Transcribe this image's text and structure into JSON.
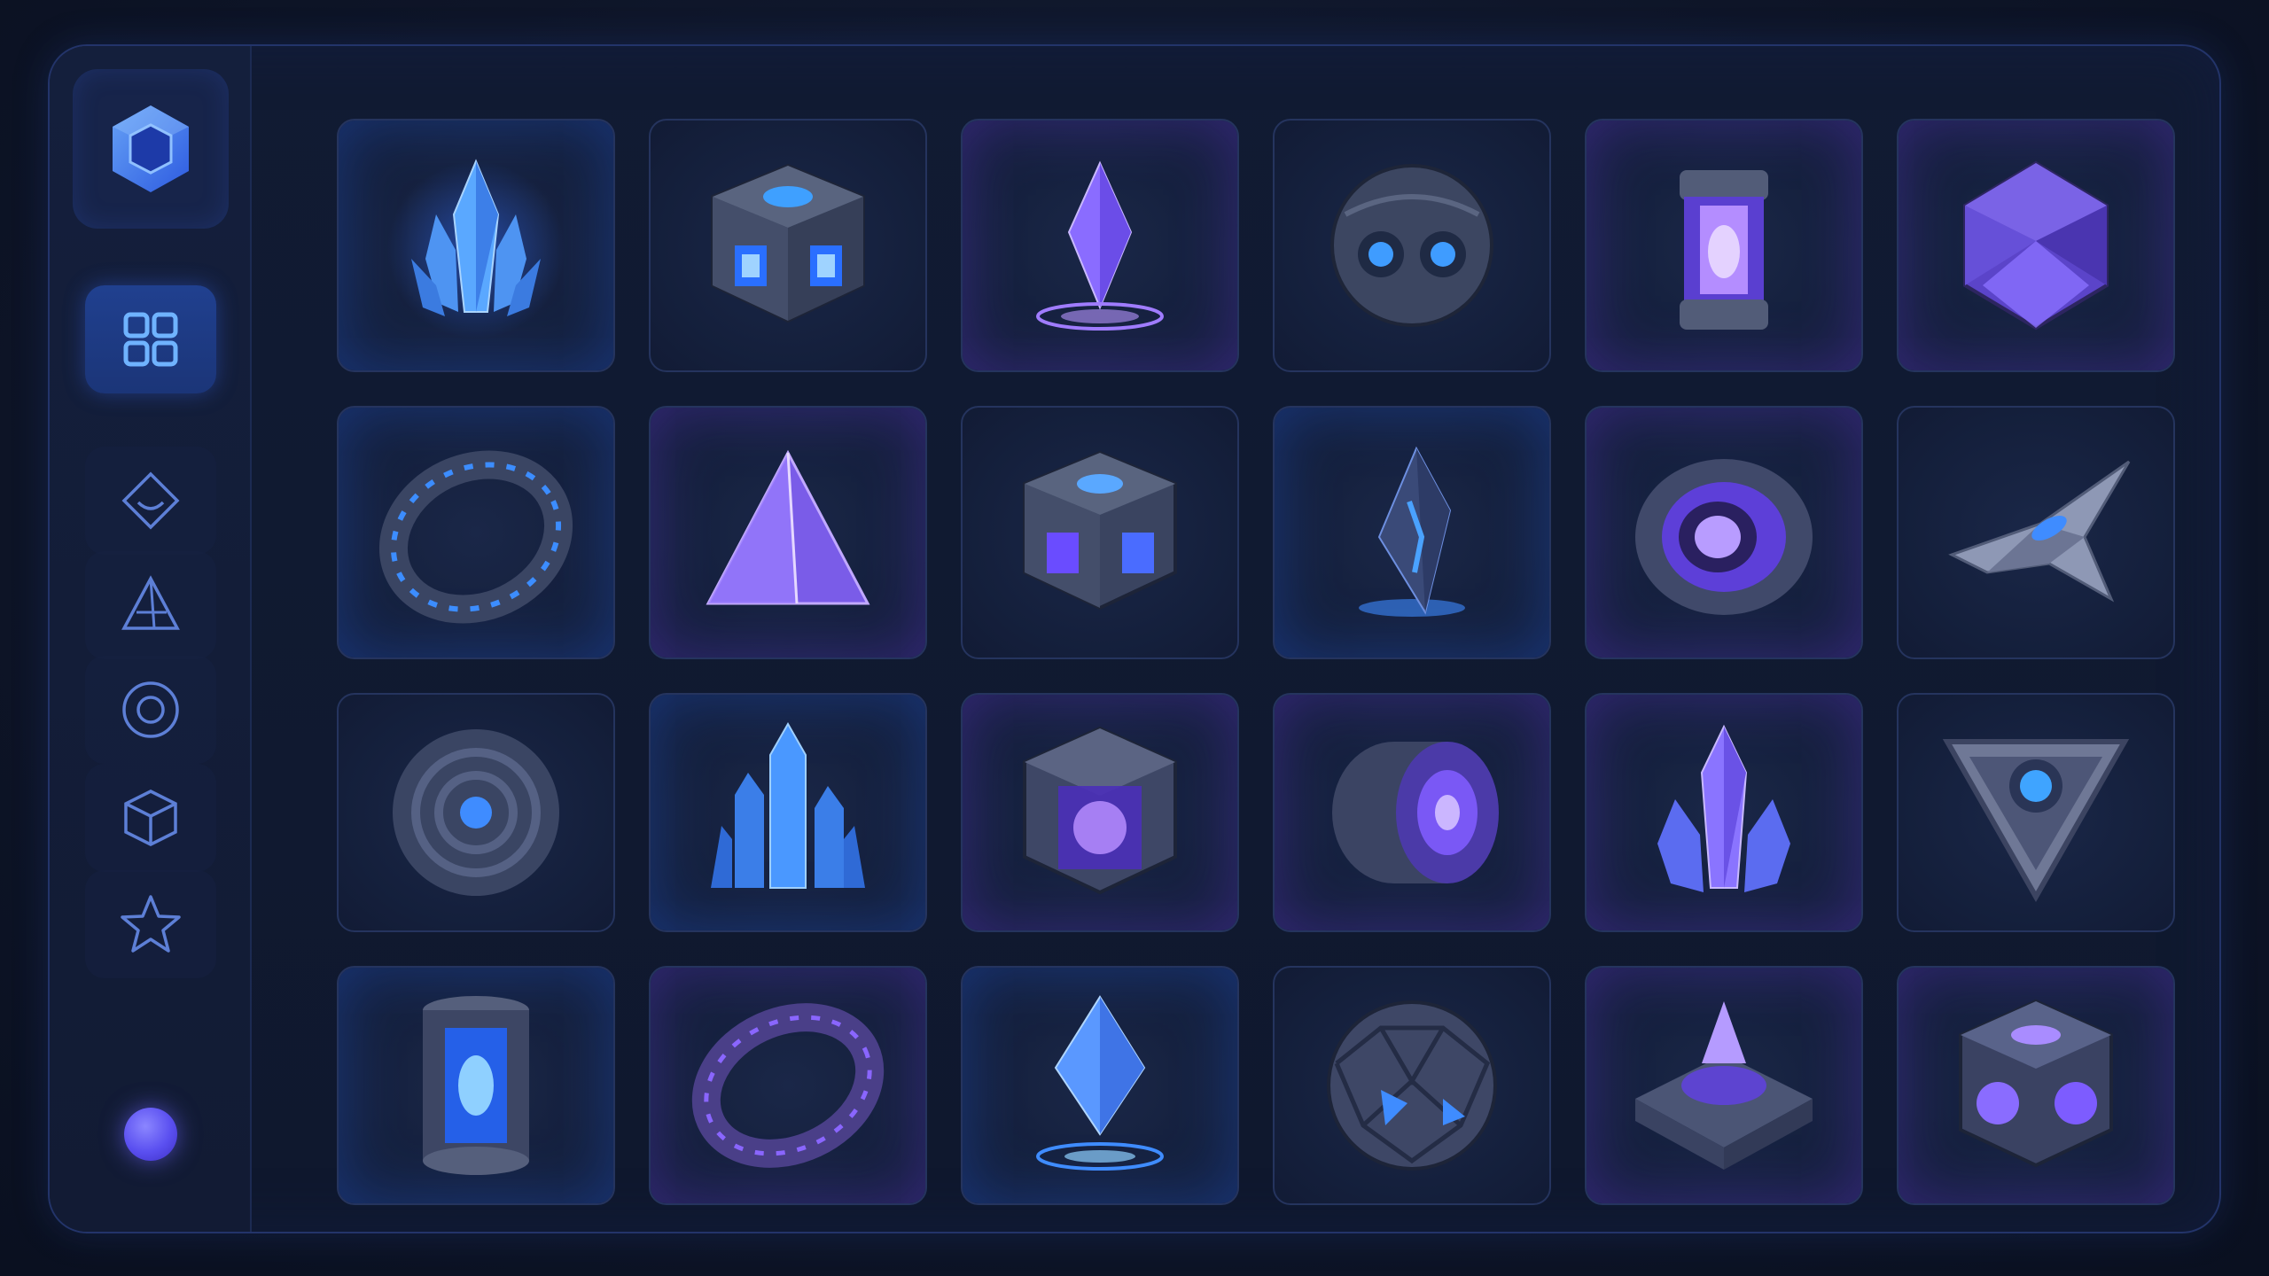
{
  "app": {
    "logo_icon": "hexagon-gem-icon",
    "accent": "#3b82f6",
    "accent_violet": "#7c5cff"
  },
  "sidebar": {
    "items": [
      {
        "id": "grid",
        "icon": "grid-icon",
        "active": true
      },
      {
        "id": "diamond",
        "icon": "diamond-icon",
        "active": false
      },
      {
        "id": "pyramid",
        "icon": "pyramid-icon",
        "active": false
      },
      {
        "id": "ring",
        "icon": "ring-icon",
        "active": false
      },
      {
        "id": "cube",
        "icon": "cube-icon",
        "active": false
      },
      {
        "id": "star",
        "icon": "star-icon",
        "active": false
      }
    ],
    "avatar": "user-avatar"
  },
  "assets": [
    {
      "icon": "blue-crystal-cluster-icon",
      "theme": "blue"
    },
    {
      "icon": "tech-cube-blue-icon",
      "theme": "blue"
    },
    {
      "icon": "violet-crystal-hologram-icon",
      "theme": "violet"
    },
    {
      "icon": "robot-sphere-icon",
      "theme": "blue"
    },
    {
      "icon": "energy-canister-violet-icon",
      "theme": "violet"
    },
    {
      "icon": "violet-polyhedron-icon",
      "theme": "violet"
    },
    {
      "icon": "tech-ring-blue-icon",
      "theme": "blue"
    },
    {
      "icon": "violet-pyramid-icon",
      "theme": "violet"
    },
    {
      "icon": "tech-cube-violet-icon",
      "theme": "violet"
    },
    {
      "icon": "blue-shard-icon",
      "theme": "blue"
    },
    {
      "icon": "violet-core-cylinder-icon",
      "theme": "violet"
    },
    {
      "icon": "spaceship-icon",
      "theme": "blue"
    },
    {
      "icon": "tech-sphere-blue-icon",
      "theme": "blue"
    },
    {
      "icon": "blue-crystal-spires-icon",
      "theme": "blue"
    },
    {
      "icon": "violet-core-cube-icon",
      "theme": "violet"
    },
    {
      "icon": "violet-barrel-icon",
      "theme": "violet"
    },
    {
      "icon": "violet-crystal-cluster-icon",
      "theme": "violet"
    },
    {
      "icon": "triangle-emblem-icon",
      "theme": "blue"
    },
    {
      "icon": "energy-canister-blue-icon",
      "theme": "blue"
    },
    {
      "icon": "tech-ring-violet-icon",
      "theme": "violet"
    },
    {
      "icon": "blue-crystal-hologram-icon",
      "theme": "blue"
    },
    {
      "icon": "geodesic-sphere-icon",
      "theme": "blue"
    },
    {
      "icon": "violet-reactor-base-icon",
      "theme": "violet"
    },
    {
      "icon": "violet-tech-cube-icon",
      "theme": "violet"
    }
  ]
}
